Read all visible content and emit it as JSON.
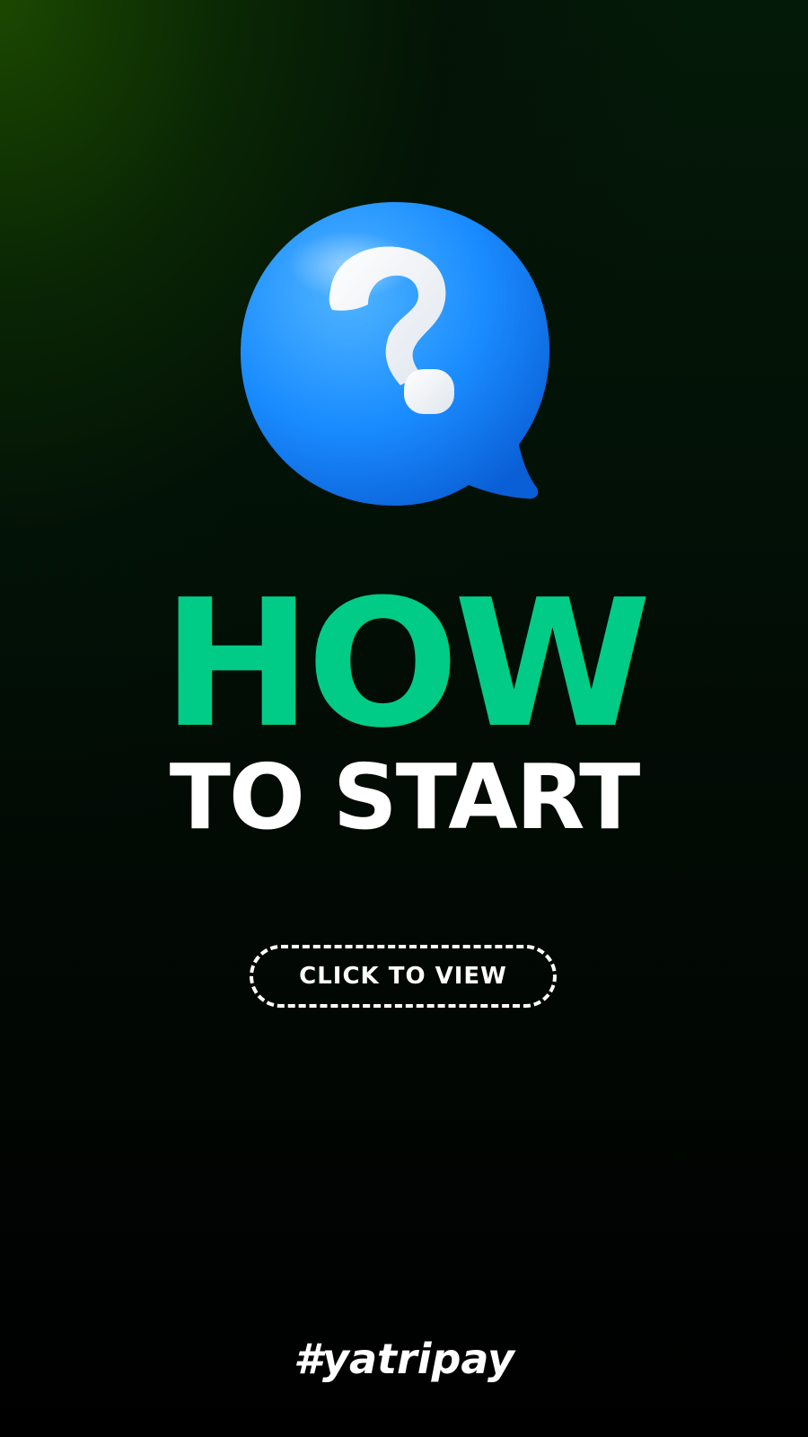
{
  "headline": {
    "line1": "HOW",
    "line2": "TO START"
  },
  "cta": {
    "label": "CLICK TO VIEW"
  },
  "footer": {
    "hashtag": "#yatripay"
  },
  "icons": {
    "hero": "question-speech-bubble-icon"
  },
  "colors": {
    "accent_green": "#00cc88",
    "bubble_blue": "#1a8cff",
    "text_white": "#ffffff"
  }
}
